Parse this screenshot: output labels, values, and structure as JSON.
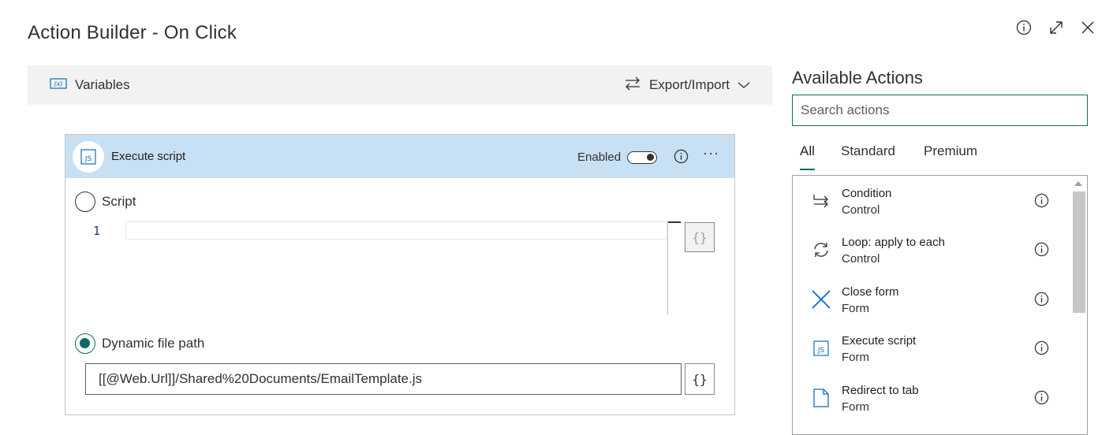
{
  "window": {
    "title": "Action Builder - On Click",
    "info_icon": "info-icon",
    "expand_icon": "expand-icon",
    "close_icon": "close-icon"
  },
  "toolbar": {
    "variables_label": "Variables",
    "export_import_label": "Export/Import"
  },
  "action_card": {
    "title": "Execute script",
    "badge": "JS",
    "enabled_label": "Enabled",
    "enabled": true,
    "script_option_label": "Script",
    "line_number": "1",
    "script_code": "",
    "brace_label": "{}",
    "dynamic_option_label": "Dynamic file path",
    "selected_option": "dynamic",
    "file_path_value": "[[@Web.Url]]/Shared%20Documents/EmailTemplate.js"
  },
  "panel": {
    "title": "Available Actions",
    "search_placeholder": "Search actions",
    "tabs": [
      {
        "label": "All",
        "active": true
      },
      {
        "label": "Standard",
        "active": false
      },
      {
        "label": "Premium",
        "active": false
      }
    ],
    "items": [
      {
        "name": "Condition",
        "category": "Control",
        "icon": "condition-icon"
      },
      {
        "name": "Loop: apply to each",
        "category": "Control",
        "icon": "loop-icon"
      },
      {
        "name": "Close form",
        "category": "Form",
        "icon": "close-form-icon"
      },
      {
        "name": "Execute script",
        "category": "Form",
        "icon": "js-icon"
      },
      {
        "name": "Redirect to tab",
        "category": "Form",
        "icon": "page-icon"
      }
    ]
  },
  "colors": {
    "accent": "#106b63",
    "card_header": "#c7e0f4",
    "toolbar_bg": "#f3f2f1",
    "icon_blue": "#0f6cbd"
  }
}
